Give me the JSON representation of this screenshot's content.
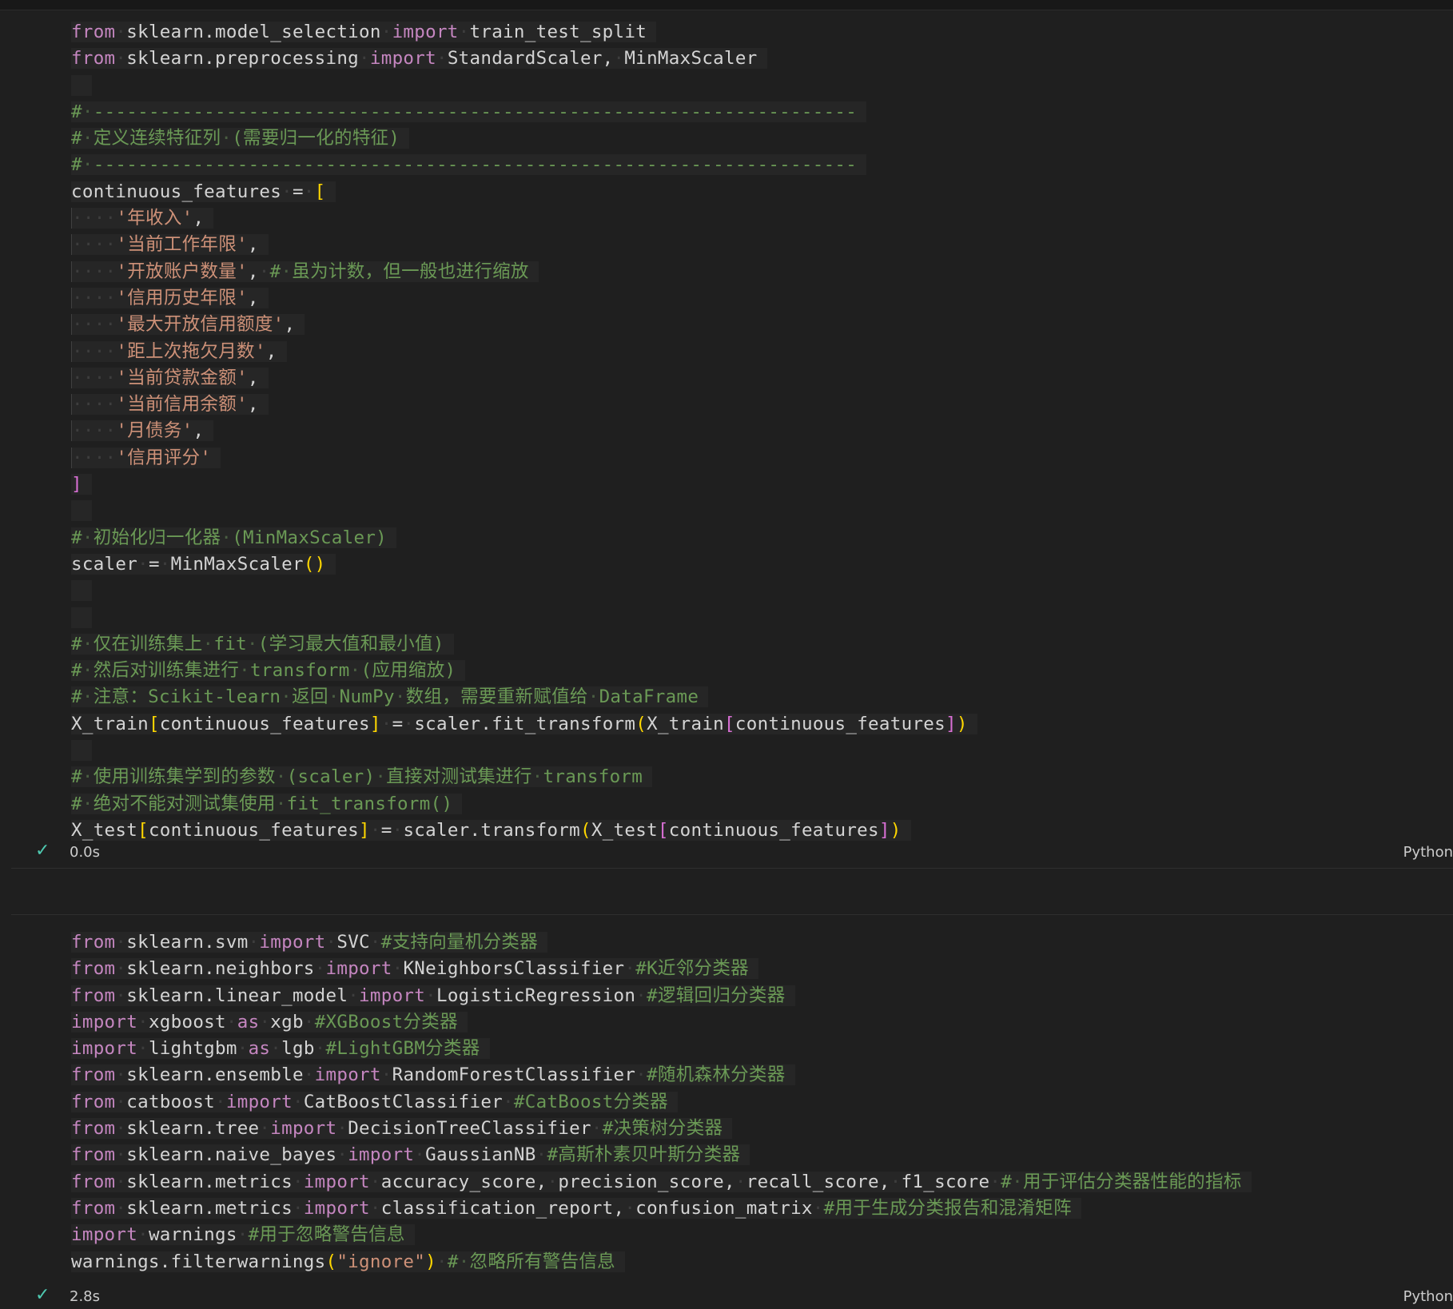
{
  "cell1": {
    "lines": [
      "from sklearn.model_selection import train_test_split",
      "from sklearn.preprocessing import StandardScaler, MinMaxScaler",
      "",
      "# ---------------------------------------------------------------------",
      "# 定义连续特征列 (需要归一化的特征)",
      "# ---------------------------------------------------------------------",
      "continuous_features = [",
      "    '年收入',",
      "    '当前工作年限',",
      "    '开放账户数量', # 虽为计数，但一般也进行缩放",
      "    '信用历史年限',",
      "    '最大开放信用额度',",
      "    '距上次拖欠月数',",
      "    '当前贷款金额',",
      "    '当前信用余额',",
      "    '月债务',",
      "    '信用评分'",
      "]",
      "",
      "# 初始化归一化器 (MinMaxScaler)",
      "scaler = MinMaxScaler()",
      "",
      "",
      "# 仅在训练集上 fit (学习最大值和最小值)",
      "# 然后对训练集进行 transform (应用缩放)",
      "# 注意：Scikit-learn 返回 NumPy 数组，需要重新赋值给 DataFrame",
      "X_train[continuous_features] = scaler.fit_transform(X_train[continuous_features])",
      "",
      "# 使用训练集学到的参数 (scaler) 直接对测试集进行 transform",
      "# 绝对不能对测试集使用 fit_transform()",
      "X_test[continuous_features] = scaler.transform(X_test[continuous_features])"
    ],
    "exec_time": "0.0s",
    "language": "Python"
  },
  "cell2": {
    "lines": [
      "from sklearn.svm import SVC #支持向量机分类器",
      "from sklearn.neighbors import KNeighborsClassifier #K近邻分类器",
      "from sklearn.linear_model import LogisticRegression #逻辑回归分类器",
      "import xgboost as xgb #XGBoost分类器",
      "import lightgbm as lgb #LightGBM分类器",
      "from sklearn.ensemble import RandomForestClassifier #随机森林分类器",
      "from catboost import CatBoostClassifier #CatBoost分类器",
      "from sklearn.tree import DecisionTreeClassifier #决策树分类器",
      "from sklearn.naive_bayes import GaussianNB #高斯朴素贝叶斯分类器",
      "from sklearn.metrics import accuracy_score, precision_score, recall_score, f1_score # 用于评估分类器性能的指标",
      "from sklearn.metrics import classification_report, confusion_matrix #用于生成分类报告和混淆矩阵",
      "import warnings #用于忽略警告信息",
      "warnings.filterwarnings(\"ignore\") # 忽略所有警告信息"
    ],
    "exec_time": "2.8s",
    "language": "Python"
  },
  "colors": {
    "keyword": "#c586c0",
    "comment": "#6a9955",
    "string": "#ce9178",
    "bracket": "#ffd700",
    "bracket_inner": "#da70d6",
    "success": "#4ec9b0",
    "background": "#1f1f1f"
  }
}
